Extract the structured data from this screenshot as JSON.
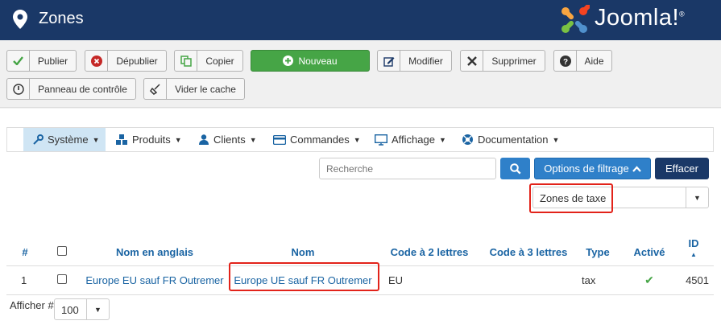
{
  "header": {
    "title": "Zones",
    "logo_text": "Joomla!",
    "logo_reg": "®"
  },
  "toolbar": {
    "publish": "Publier",
    "unpublish": "Dépublier",
    "copy": "Copier",
    "new": "Nouveau",
    "edit": "Modifier",
    "delete": "Supprimer",
    "help": "Aide",
    "control_panel": "Panneau de contrôle",
    "clear_cache": "Vider le cache"
  },
  "menu": {
    "items": [
      {
        "label": "Système",
        "icon": "wrench-icon"
      },
      {
        "label": "Produits",
        "icon": "cubes-icon"
      },
      {
        "label": "Clients",
        "icon": "user-icon"
      },
      {
        "label": "Commandes",
        "icon": "credit-card-icon"
      },
      {
        "label": "Affichage",
        "icon": "monitor-icon"
      },
      {
        "label": "Documentation",
        "icon": "lifebuoy-icon"
      }
    ]
  },
  "filters": {
    "search_placeholder": "Recherche",
    "filter_options": "Options de filtrage",
    "clear": "Effacer",
    "zone_type": "Zones de taxe"
  },
  "table": {
    "headers": {
      "num": "#",
      "name_en": "Nom en anglais",
      "name": "Nom",
      "code2": "Code à 2 lettres",
      "code3": "Code à 3 lettres",
      "type": "Type",
      "active": "Activé",
      "id": "ID",
      "id_sort": "▲"
    },
    "rows": [
      {
        "num": "1",
        "name_en": "Europe EU sauf FR Outremer",
        "name": "Europe UE sauf FR Outremer",
        "code2": "EU",
        "code3": "",
        "type": "tax",
        "active": "✔",
        "id": "4501"
      }
    ]
  },
  "footer": {
    "label": "Afficher #",
    "limit": "100"
  },
  "colors": {
    "header_bg": "#1a3867",
    "primary": "#2f80c9",
    "success": "#46a546",
    "highlight": "#e2231a",
    "link": "#1a64a3"
  }
}
